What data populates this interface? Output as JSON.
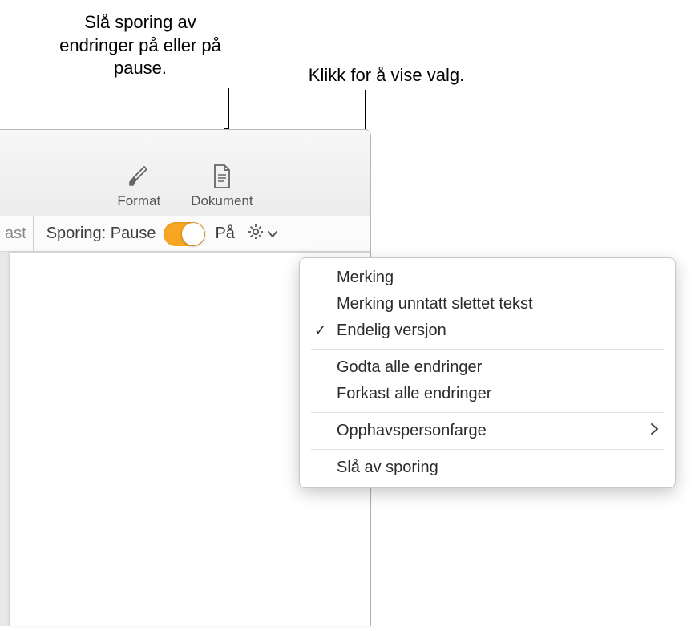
{
  "callouts": {
    "left": "Slå sporing av endringer på eller på pause.",
    "right": "Klikk for å vise valg."
  },
  "toolbar": {
    "format_label": "Format",
    "document_label": "Dokument"
  },
  "secondary": {
    "cutoff_text": "ast",
    "sporing_label": "Sporing:",
    "state_label": "Pause",
    "on_label": "På"
  },
  "menu": {
    "items": [
      {
        "label": "Merking"
      },
      {
        "label": "Merking unntatt slettet tekst"
      },
      {
        "label": "Endelig versjon",
        "checked": true
      }
    ],
    "items2": [
      {
        "label": "Godta alle endringer"
      },
      {
        "label": "Forkast alle endringer"
      }
    ],
    "items3": [
      {
        "label": "Opphavspersonfarge",
        "submenu": true
      }
    ],
    "items4": [
      {
        "label": "Slå av sporing"
      }
    ]
  },
  "icons": {
    "gear": "gear-icon",
    "chevron_down": "chevron-down-icon",
    "chevron_right": "chevron-right-icon",
    "brush": "brush-icon",
    "document": "document-icon",
    "check": "✓"
  }
}
